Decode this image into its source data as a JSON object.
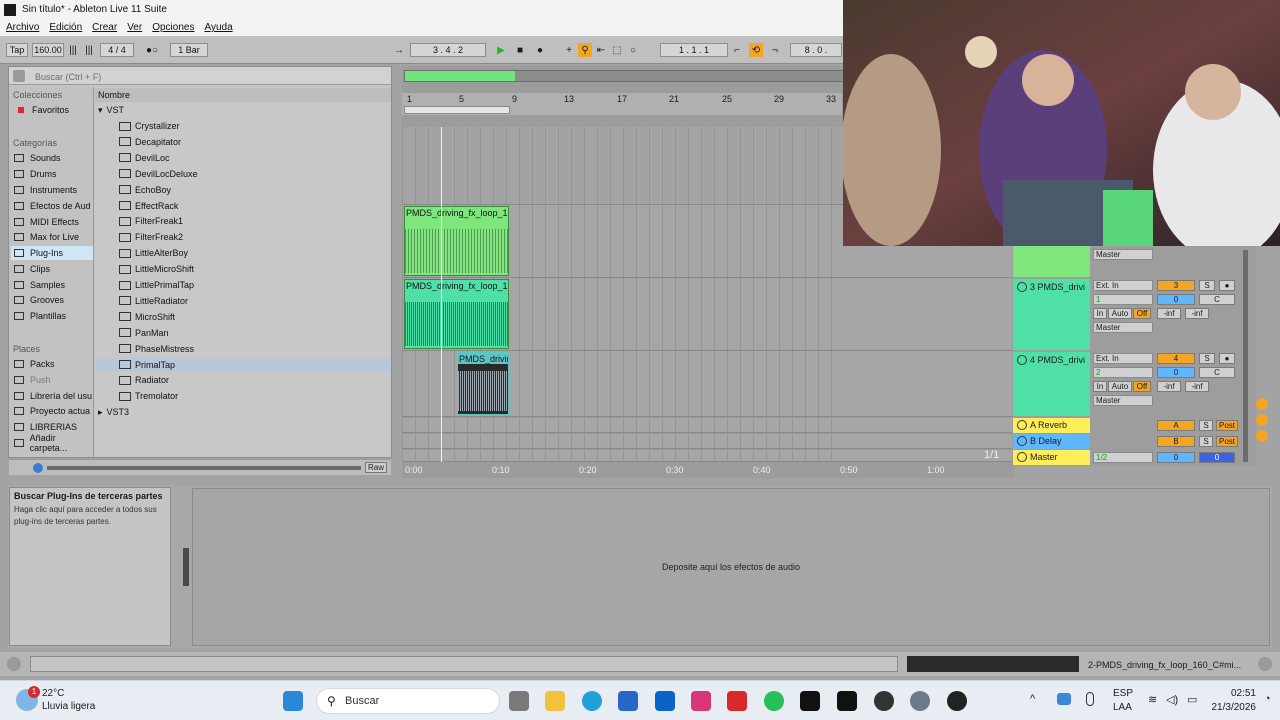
{
  "window": {
    "title": "Sin título* - Ableton Live 11 Suite"
  },
  "menu": [
    "Archivo",
    "Edición",
    "Crear",
    "Ver",
    "Opciones",
    "Ayuda"
  ],
  "transport": {
    "tap": "Tap",
    "tempo": "160.00",
    "signature": "4 / 4",
    "quantize": "1 Bar",
    "position": "3 .  4 .  2",
    "loop_start": "1 .  1 .  1",
    "loop_len": "8 .  0 ."
  },
  "browser": {
    "search_placeholder": "Buscar (Ctrl + F)",
    "colecciones": "Colecciones",
    "favoritos": "Favoritos",
    "categorias": "Categorías",
    "categories": [
      "Sounds",
      "Drums",
      "Instruments",
      "Efectos de Aud",
      "MIDI Effects",
      "Max for Live",
      "Plug-Ins",
      "Clips",
      "Samples",
      "Grooves",
      "Plantillas"
    ],
    "places_header": "Places",
    "places": [
      "Packs",
      "Push",
      "Librería del usu",
      "Proyecto actua",
      "LIBRERIAS",
      "Añadir carpeta..."
    ],
    "nombre_header": "Nombre",
    "folder_vst": "VST",
    "plugins": [
      "Crystallizer",
      "Decapitator",
      "DevilLoc",
      "DevilLocDeluxe",
      "EchoBoy",
      "EffectRack",
      "FilterFreak1",
      "FilterFreak2",
      "LittleAlterBoy",
      "LittleMicroShift",
      "LittlePrimalTap",
      "LittleRadiator",
      "MicroShift",
      "PanMan",
      "PhaseMistress",
      "PrimalTap",
      "Radiator",
      "Tremolator"
    ],
    "folder_vst3": "VST3",
    "raw": "Raw"
  },
  "arrangement": {
    "ruler": [
      "1",
      "5",
      "9",
      "13",
      "17",
      "21",
      "25",
      "29",
      "33"
    ],
    "clips": [
      "PMDS_driving_fx_loop_1",
      "PMDS_driving_fx_loop_1",
      "PMDS_drivin"
    ],
    "time_ruler": [
      "0:00",
      "0:10",
      "0:20",
      "0:30",
      "0:40",
      "0:50",
      "1:00"
    ],
    "page": "1/1"
  },
  "mixer": {
    "tracks": [
      {
        "name": "3 PMDS_drivi",
        "input": "Ext. In",
        "channel": "1",
        "output": "Master",
        "num": "3",
        "sends": "0",
        "pan": "C"
      },
      {
        "name": "4 PMDS_drivi",
        "input": "Ext. In",
        "channel": "2",
        "output": "Master",
        "num": "4",
        "sends": "0",
        "pan": "C"
      }
    ],
    "top_output": "Master",
    "in": "In",
    "auto": "Auto",
    "off": "Off",
    "inf1": "-inf",
    "inf2": "-inf",
    "solo": "S",
    "returns": [
      {
        "name": "A Reverb",
        "letter": "A",
        "post": "Post"
      },
      {
        "name": "B Delay",
        "letter": "B",
        "post": "Post"
      }
    ],
    "master": {
      "name": "Master",
      "cue": "1/2",
      "val1": "0",
      "val2": "0"
    }
  },
  "info": {
    "title": "Buscar Plug-Ins de terceras partes",
    "body": "Haga clic aquí para acceder a todos sus plug-ins de terceras partes."
  },
  "device_drop": "Deposite aquí los efectos de audio",
  "status_clip": "2-PMDS_driving_fx_loop_160_C#mi...",
  "taskbar": {
    "weather_temp": "22°C",
    "weather_desc": "Lluvia ligera",
    "weather_badge": "1",
    "search": "Buscar",
    "lang1": "ESP",
    "lang2": "LAA",
    "time": "02:51",
    "date": "21/3/2026"
  },
  "colors": {
    "clip_green": "#7ee67c",
    "clip_teal": "#4fe0a7",
    "accent_orange": "#f5a524",
    "return_yellow": "#ffee5a",
    "return_blue": "#5fb8ff"
  }
}
